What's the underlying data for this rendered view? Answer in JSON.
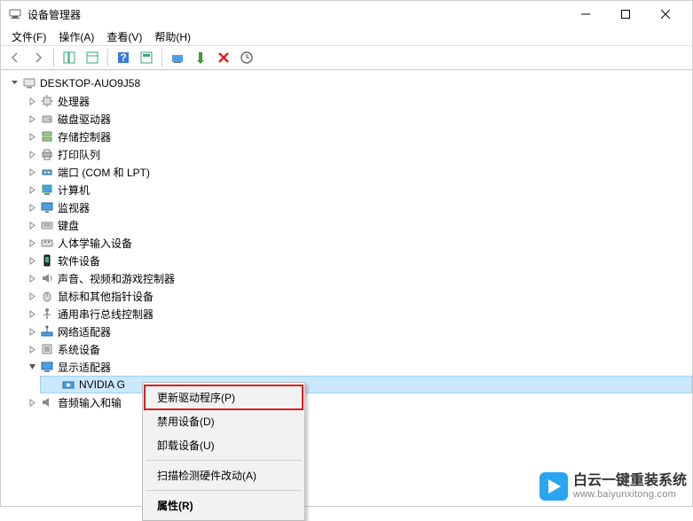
{
  "window": {
    "title": "设备管理器",
    "minimize_icon": "minimize",
    "maximize_icon": "maximize",
    "close_icon": "close"
  },
  "menubar": {
    "items": [
      {
        "label": "文件(F)"
      },
      {
        "label": "操作(A)"
      },
      {
        "label": "查看(V)"
      },
      {
        "label": "帮助(H)"
      }
    ]
  },
  "toolbar": {
    "back": "back",
    "forward": "forward",
    "show_hide": "show-hide",
    "properties": "properties",
    "help": "help",
    "refresh": "refresh",
    "scan": "scan",
    "enable": "enable",
    "uninstall": "uninstall",
    "options": "options"
  },
  "tree": {
    "root": {
      "label": "DESKTOP-AUO9J58",
      "icon": "computer"
    },
    "categories": [
      {
        "label": "处理器",
        "icon": "cpu",
        "expanded": false
      },
      {
        "label": "磁盘驱动器",
        "icon": "disk",
        "expanded": false
      },
      {
        "label": "存储控制器",
        "icon": "storage",
        "expanded": false
      },
      {
        "label": "打印队列",
        "icon": "printer",
        "expanded": false
      },
      {
        "label": "端口 (COM 和 LPT)",
        "icon": "port",
        "expanded": false
      },
      {
        "label": "计算机",
        "icon": "pc",
        "expanded": false
      },
      {
        "label": "监视器",
        "icon": "monitor",
        "expanded": false
      },
      {
        "label": "键盘",
        "icon": "keyboard",
        "expanded": false
      },
      {
        "label": "人体学输入设备",
        "icon": "hid",
        "expanded": false
      },
      {
        "label": "软件设备",
        "icon": "software",
        "expanded": false
      },
      {
        "label": "声音、视频和游戏控制器",
        "icon": "sound",
        "expanded": false
      },
      {
        "label": "鼠标和其他指针设备",
        "icon": "mouse",
        "expanded": false
      },
      {
        "label": "通用串行总线控制器",
        "icon": "usb",
        "expanded": false
      },
      {
        "label": "网络适配器",
        "icon": "network",
        "expanded": false
      },
      {
        "label": "系统设备",
        "icon": "system",
        "expanded": false
      },
      {
        "label": "显示适配器",
        "icon": "display",
        "expanded": true,
        "children": [
          {
            "label": "NVIDIA G",
            "icon": "gpu",
            "selected": true
          }
        ]
      },
      {
        "label": "音频输入和输",
        "icon": "audio",
        "expanded": false
      }
    ]
  },
  "context_menu": {
    "items": [
      {
        "label": "更新驱动程序(P)",
        "highlighted": true
      },
      {
        "label": "禁用设备(D)"
      },
      {
        "label": "卸载设备(U)"
      },
      {
        "sep": true
      },
      {
        "label": "扫描检测硬件改动(A)"
      },
      {
        "sep": true
      },
      {
        "label": "属性(R)",
        "bold": true
      }
    ]
  },
  "watermark": {
    "title": "白云一键重装系统",
    "url": "www.baiyunxitong.com"
  }
}
